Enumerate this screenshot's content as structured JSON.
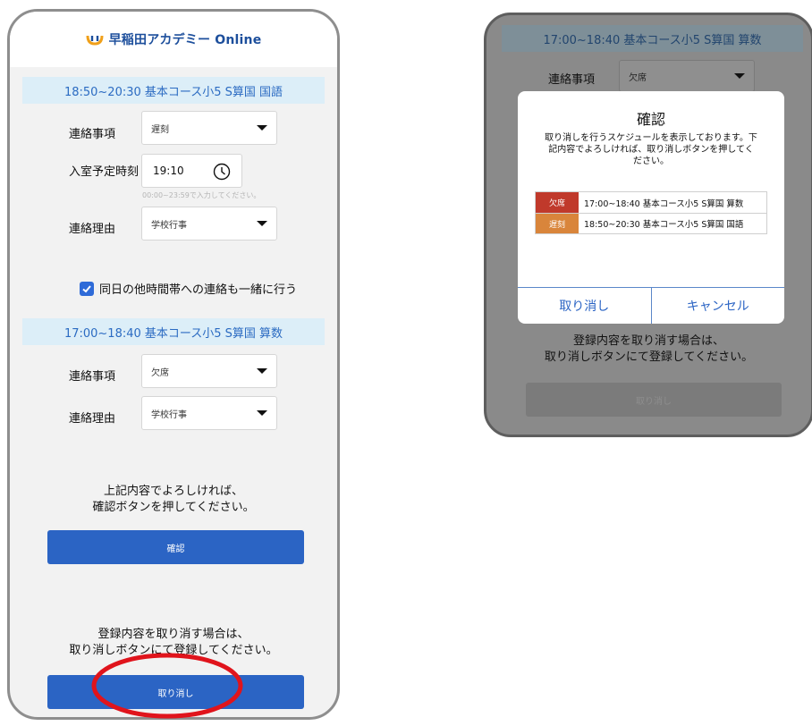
{
  "brand": {
    "logo_text": "早稲田アカデミー Online"
  },
  "form": {
    "section1": {
      "title": "18:50~20:30 基本コース小5 S算国 国語",
      "contact_label": "連絡事項",
      "contact_value": "遅刻",
      "time_label": "入室予定時刻",
      "time_value": "19:10",
      "time_hint": "00:00~23:59で入力してください。",
      "reason_label": "連絡理由",
      "reason_value": "学校行事"
    },
    "same_day_checkbox_label": "同日の他時間帯への連絡も一緒に行う",
    "section2": {
      "title": "17:00~18:40 基本コース小5 S算国 算数",
      "contact_label": "連絡事項",
      "contact_value": "欠席",
      "reason_label": "連絡理由",
      "reason_value": "学校行事"
    },
    "confirm_note_line1": "上記内容でよろしければ、",
    "confirm_note_line2": "確認ボタンを押してください。",
    "confirm_button": "確認",
    "cancel_note_line1": "登録内容を取り消す場合は、",
    "cancel_note_line2": "取り消しボタンにて登録してください。",
    "cancel_button": "取り消し"
  },
  "right_screen": {
    "banner": "17:00~18:40 基本コース小5 S算国 算数",
    "contact_label": "連絡事項",
    "contact_value": "欠席",
    "note_line1": "登録内容を取り消す場合は、",
    "note_line2": "取り消しボタンにて登録してください。",
    "cancel_button": "取り消し"
  },
  "dialog": {
    "title": "確認",
    "message": "取り消しを行うスケジュールを表示しております。下記内容でよろしければ、取り消しボタンを押してください。",
    "rows": [
      {
        "badge": "欠席",
        "badge_color": "#c0392b",
        "text": "17:00~18:40 基本コース小5 S算国 算数"
      },
      {
        "badge": "遅刻",
        "badge_color": "#d9853b",
        "text": "18:50~20:30 基本コース小5 S算国 国語"
      }
    ],
    "ok_button": "取り消し",
    "cancel_button": "キャンセル"
  },
  "colors": {
    "accent_blue": "#2b64c4",
    "banner_bg": "#dceef8",
    "annotation_red": "#e0141c"
  }
}
